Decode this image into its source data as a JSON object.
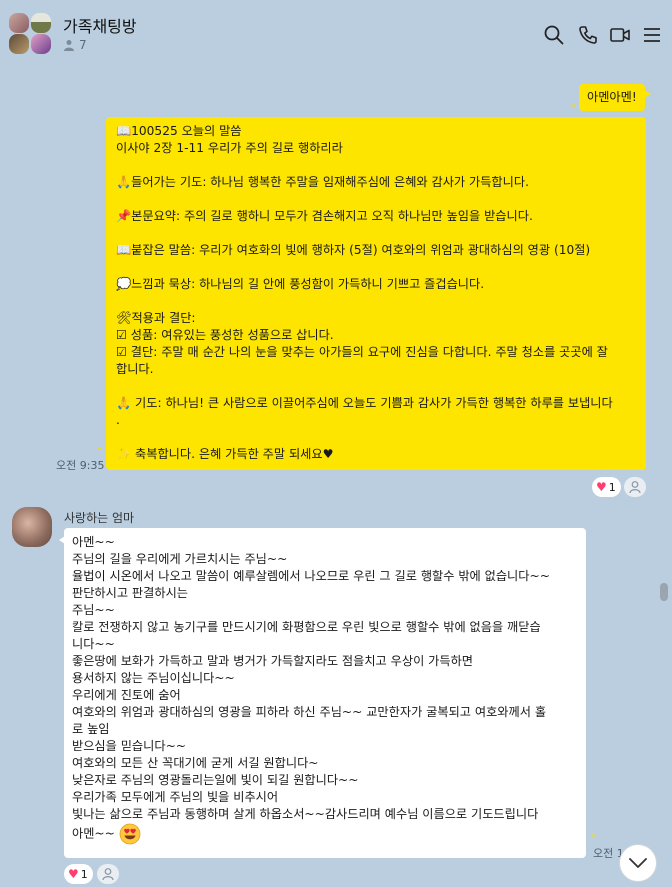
{
  "header": {
    "title": "가족채팅방",
    "member_count": "7",
    "icons": [
      "search-icon",
      "phone-icon",
      "video-call-icon",
      "menu-icon"
    ]
  },
  "messages": {
    "amen": {
      "text": "아멘아멘!"
    },
    "devotion": {
      "lines": [
        "📖100525 오늘의 말씀",
        "이사야 2장 1-11 우리가 주의 길로 행하리라",
        "",
        "🙏들어가는 기도: 하나님 행복한 주말을 임재해주심에 은혜와 감사가 가득합니다.",
        "",
        "📌본문요약: 주의 길로 행하니 모두가 겸손해지고 오직 하나님만 높임을 받습니다.",
        "",
        "📖붙잡은 말씀: 우리가 여호화의 빛에 행하자 (5절) 여호와의 위엄과 광대하심의 영광 (10절)",
        "",
        "💭느낌과 묵상: 하나님의 길 안에 풍성함이 가득하니 기쁘고 즐겁습니다.",
        "",
        "🛠적용과 결단:",
        "☑ 성품: 여유있는 풍성한 성품으로 삽니다.",
        "☑ 결단: 주말 매 순간 나의 눈을 맞추는 아가들의 요구에 진심을 다합니다. 주말 청소를 곳곳에 잘",
        "합니다.",
        "",
        "🙏 기도: 하나님! 큰 사람으로 이끌어주심에 오늘도 기쁨과 감사가 가득한 행복한 하루를 보냅니다",
        ".",
        "",
        "✨ 축복합니다. 은혜 가득한 주말 되세요♥"
      ],
      "time": "오전 9:35",
      "reaction_count": "1"
    },
    "mom": {
      "sender": "사랑하는 엄마",
      "lines": [
        "아멘~~",
        "주님의 길을 우리에게 가르치시는 주님~~",
        "율법이 시온에서 나오고 말씀이 예루살렘에서 나오므로 우린 그 길로 행할수 밖에 없습니다~~",
        "판단하시고 판결하시는",
        "주님~~",
        "칼로 전쟁하지 않고 농기구를 만드시기에 화평함으로 우린 빛으로 행할수 밖에 없음을 깨닫습",
        "니다~~",
        "좋은땅에 보화가 가득하고 말과 병거가 가득할지라도 점을치고 우상이 가득하면",
        "용서하지 않는 주님이십니다~~",
        "우리에게 진토에 숨어",
        "여호와의 위엄과 광대하심의 영광을 피하라 하신 주님~~ 교만한자가 굴복되고 여호와께서 홀",
        "로 높임",
        "받으심을 믿습니다~~",
        "여호와의 모든 산 꼭대기에 굳게 서길 원합니다~",
        "낮은자로 주님의 영광돌리는일에 빛이 되길 원합니다~~",
        "우리가족 모두에게 주님의 빛을 비추시어",
        "빛나는 삶으로 주님과 동행하며 살게 하옵소서~~감사드리며 예수님 이름으로 기도드립니다"
      ],
      "last_line": "아멘~~",
      "time": "오전 1",
      "reaction_count": "1"
    }
  },
  "colors": {
    "background": "#bacee0",
    "my_bubble": "#fee500",
    "other_bubble": "#ffffff",
    "heart": "#ff3d6e"
  }
}
